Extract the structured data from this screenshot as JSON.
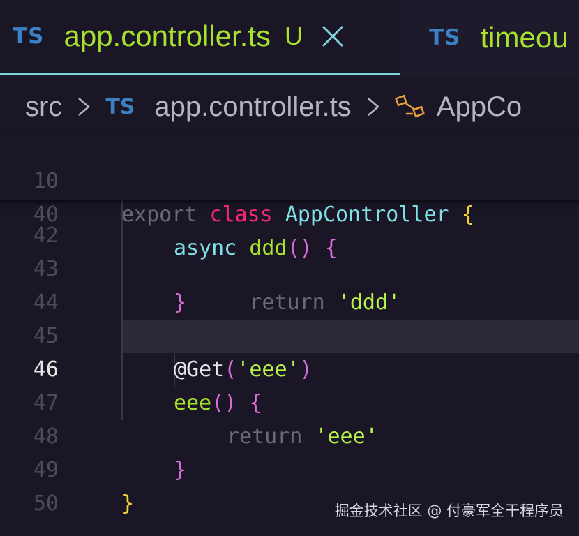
{
  "tabs": [
    {
      "badge": "TS",
      "name": "app.controller.ts",
      "status": "U",
      "active": true
    },
    {
      "badge": "TS",
      "name": "timeou",
      "active": false
    }
  ],
  "breadcrumb": {
    "folder": "src",
    "file_badge": "TS",
    "file": "app.controller.ts",
    "symbol": "AppCo",
    "symbol_icon": "class-icon"
  },
  "sticky_lines": [
    {
      "number": "10",
      "tokens": [
        "export",
        "class",
        "AppController",
        "{"
      ]
    },
    {
      "number": "40",
      "tokens": [
        "async",
        "ddd",
        "()",
        "{"
      ]
    }
  ],
  "lines": [
    {
      "number": "42",
      "tokens": [
        "return",
        "'ddd'"
      ]
    },
    {
      "number": "43",
      "tokens": [
        "}"
      ]
    },
    {
      "number": "44",
      "tokens": []
    },
    {
      "number": "45",
      "tokens": [
        "@Get",
        "(",
        "'eee'",
        ")"
      ]
    },
    {
      "number": "46",
      "tokens": [
        "eee",
        "()",
        "{"
      ],
      "current": true
    },
    {
      "number": "47",
      "tokens": [
        "return",
        "'eee'"
      ]
    },
    {
      "number": "48",
      "tokens": [
        "}"
      ]
    },
    {
      "number": "49",
      "tokens": [
        "}"
      ]
    },
    {
      "number": "50",
      "tokens": []
    }
  ],
  "watermark": "掘金技术社区 @ 付豪军全干程序员",
  "colors": {
    "background": "#1a1625",
    "tab_active_border": "#7dd3dc",
    "ts_badge": "#3b82c4",
    "keyword": "#f92672",
    "class_name": "#7fe0e8",
    "function": "#a6e22e",
    "string": "#b6f14a",
    "brace_outer": "#f7d038",
    "brace_inner": "#d66fd6"
  }
}
